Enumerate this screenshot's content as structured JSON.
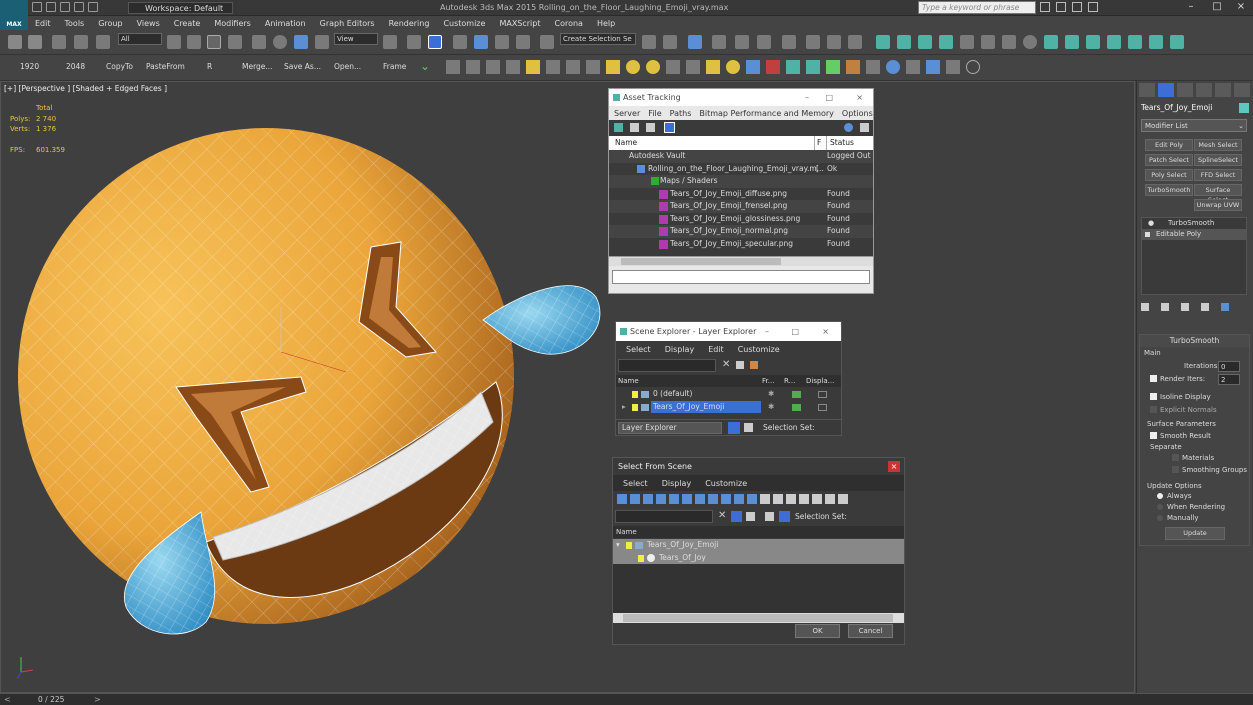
{
  "app": {
    "logo_label": "MAX",
    "window_title": "Autodesk 3ds Max  2015     Rolling_on_the_Floor_Laughing_Emoji_vray.max",
    "workspace": "Workspace: Default",
    "search_placeholder": "Type a keyword or phrase"
  },
  "menubar": [
    "Edit",
    "Tools",
    "Group",
    "Views",
    "Create",
    "Modifiers",
    "Animation",
    "Graph Editors",
    "Rendering",
    "Customize",
    "MAXScript",
    "Corona",
    "Help"
  ],
  "toolbar1": {
    "filter": "All",
    "refcoord": "View",
    "selection_set": "Create Selection Se"
  },
  "toolbar2": [
    "1920",
    "2048",
    "CopyTo",
    "PasteFrom",
    "R",
    "Merge...",
    "Save As...",
    "Open...",
    "Frame"
  ],
  "viewport": {
    "label": "[+] [Perspective ] [Shaded + Edged Faces ]",
    "stats": {
      "header": "Total",
      "polys_label": "Polys:",
      "polys": "2 740",
      "verts_label": "Verts:",
      "verts": "1 376",
      "fps_label": "FPS:",
      "fps": "601.359"
    }
  },
  "asset_tracking": {
    "title": "Asset Tracking",
    "menu": [
      "Server",
      "File",
      "Paths",
      "Bitmap Performance and Memory",
      "Options"
    ],
    "columns": [
      "Name",
      "F",
      "Status"
    ],
    "rows": [
      {
        "name": "Autodesk Vault",
        "f": "",
        "status": "Logged Out"
      },
      {
        "name": "Rolling_on_the_Floor_Laughing_Emoji_vray.m...",
        "f": "[",
        "status": "Ok"
      },
      {
        "name": "Maps / Shaders",
        "f": "",
        "status": ""
      },
      {
        "name": "Tears_Of_Joy_Emoji_diffuse.png",
        "f": "",
        "status": "Found"
      },
      {
        "name": "Tears_Of_Joy_Emoji_frensel.png",
        "f": "",
        "status": "Found"
      },
      {
        "name": "Tears_Of_Joy_Emoji_glossiness.png",
        "f": "",
        "status": "Found"
      },
      {
        "name": "Tears_Of_Joy_Emoji_normal.png",
        "f": "",
        "status": "Found"
      },
      {
        "name": "Tears_Of_Joy_Emoji_specular.png",
        "f": "",
        "status": "Found"
      }
    ]
  },
  "scene_explorer": {
    "title": "Scene Explorer - Layer Explorer",
    "menu": [
      "Select",
      "Display",
      "Edit",
      "Customize"
    ],
    "columns": [
      "Name",
      "Fr...",
      "R...",
      "Displa..."
    ],
    "rows": [
      "0 (default)",
      "Tears_Of_Joy_Emoji"
    ],
    "footer_dropdown": "Layer Explorer",
    "selection_set_label": "Selection Set:"
  },
  "select_from_scene": {
    "title": "Select From Scene",
    "menu": [
      "Select",
      "Display",
      "Customize"
    ],
    "column": "Name",
    "rows": [
      "Tears_Of_Joy_Emoji",
      "Tears_Of_Joy"
    ],
    "selection_set_label": "Selection Set:",
    "ok": "OK",
    "cancel": "Cancel"
  },
  "command_panel": {
    "object_name": "Tears_Of_Joy_Emoji",
    "modifier_list": "Modifier List",
    "buttons": [
      "Edit Poly",
      "Mesh Select",
      "Patch Select",
      "SplineSelect",
      "Poly Select",
      "FFD Select",
      "TurboSmooth",
      "Surface Select",
      "Unwrap UVW"
    ],
    "stack": [
      "TurboSmooth",
      "Editable Poly"
    ],
    "rollout_title": "TurboSmooth",
    "main_label": "Main",
    "iterations_label": "Iterations:",
    "iterations": "0",
    "render_iters_label": "Render Iters:",
    "render_iters": "2",
    "isoline": "Isoline Display",
    "explicit_normals": "Explicit Normals",
    "surface_params": "Surface Parameters",
    "smooth_result": "Smooth Result",
    "separate": "Separate",
    "materials": "Materials",
    "smoothing_groups": "Smoothing Groups",
    "update_options": "Update Options",
    "always": "Always",
    "when_rendering": "When Rendering",
    "manually": "Manually",
    "update": "Update"
  },
  "status": {
    "frame": "0 / 225"
  },
  "colors": {
    "emoji": "#f0a83a",
    "tear": "#4fb2dc",
    "bg": "#3f3f3f",
    "selection": "#3b6fd6"
  }
}
